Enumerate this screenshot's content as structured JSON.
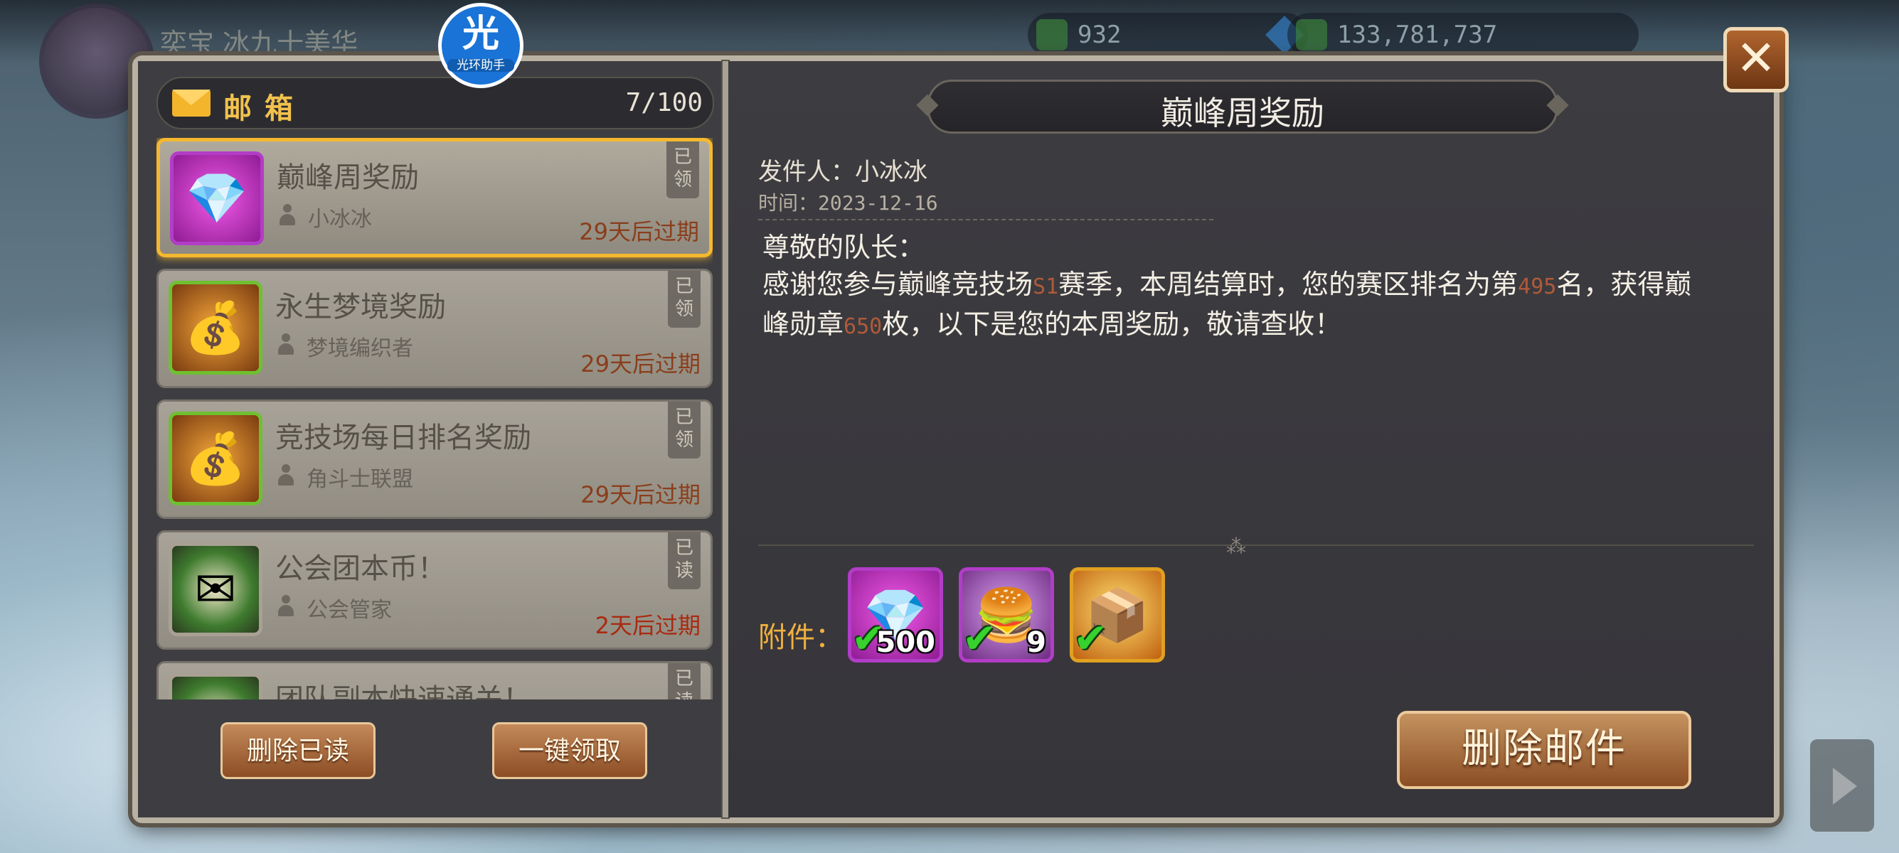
{
  "background": {
    "player_name": "奕宝 冰九十美华",
    "resources": [
      {
        "icon": "gem-icon",
        "value": "932"
      },
      {
        "icon": "gold-icon",
        "value": "133,781,737"
      }
    ]
  },
  "helper_badge": {
    "main": "光",
    "sub": "光环助手"
  },
  "mailbox": {
    "title": "邮箱",
    "count": "7/100",
    "items": [
      {
        "title": "巅峰周奖励",
        "sender": "小冰冰",
        "expire": "29天后过期",
        "status": "已领",
        "icon": "diamond-icon"
      },
      {
        "title": "永生梦境奖励",
        "sender": "梦境编织者",
        "expire": "29天后过期",
        "status": "已领",
        "icon": "gold-bag-icon"
      },
      {
        "title": "竞技场每日排名奖励",
        "sender": "角斗士联盟",
        "expire": "29天后过期",
        "status": "已领",
        "icon": "gold-bag-icon"
      },
      {
        "title": "公会团本币！",
        "sender": "公会管家",
        "expire": "2天后过期",
        "status": "已读",
        "icon": "letter-wreath-icon"
      },
      {
        "title": "团队副本快速通关！",
        "sender": "",
        "expire": "",
        "status": "已读",
        "icon": "letter-wreath-icon"
      }
    ],
    "delete_read_label": "删除已读",
    "claim_all_label": "一键领取"
  },
  "detail": {
    "title": "巅峰周奖励",
    "sender_line": "发件人：小冰冰",
    "time_line": "时间：2023-12-16",
    "greeting": "尊敬的队长：",
    "body_1": "感谢您参与巅峰竞技场",
    "season": "S1",
    "body_2": "赛季，本周结算时，您的赛区排名为第",
    "rank": "495",
    "body_3": "名，获得巅峰勋章",
    "medals": "650",
    "body_4": "枚，以下是您的本周奖励，敬请查收！",
    "attachment_label": "附件：",
    "attachments": [
      {
        "icon": "diamond-icon",
        "qty": "500",
        "claimed": true
      },
      {
        "icon": "burger-icon",
        "qty": "9",
        "claimed": true
      },
      {
        "icon": "chest-icon",
        "qty": "",
        "claimed": true
      }
    ],
    "delete_label": "删除邮件"
  },
  "close_label": "✕",
  "colors": {
    "accent_gold": "#f5b82e",
    "highlight_number": "#b05a3a",
    "attachment_label": "#f0b040"
  }
}
